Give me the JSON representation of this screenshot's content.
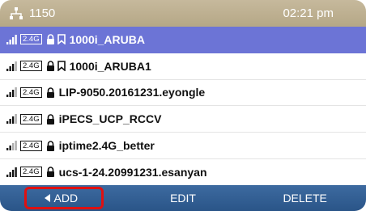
{
  "status_bar": {
    "extension": "1150",
    "time": "02:21 pm",
    "network_icon": "network-icon"
  },
  "wifi_list": [
    {
      "signal": 4,
      "band": "2.4G",
      "secured": true,
      "saved": true,
      "ssid": "1000i_ARUBA",
      "selected": true
    },
    {
      "signal": 3,
      "band": "2.4G",
      "secured": true,
      "saved": true,
      "ssid": "1000i_ARUBA1",
      "selected": false
    },
    {
      "signal": 3,
      "band": "2.4G",
      "secured": true,
      "saved": false,
      "ssid": "LIP-9050.20161231.eyongle",
      "selected": false
    },
    {
      "signal": 3,
      "band": "2.4G",
      "secured": true,
      "saved": false,
      "ssid": "iPECS_UCP_RCCV",
      "selected": false
    },
    {
      "signal": 2,
      "band": "2.4G",
      "secured": true,
      "saved": false,
      "ssid": "iptime2.4G_better",
      "selected": false
    },
    {
      "signal": 4,
      "band": "2.4G",
      "secured": true,
      "saved": false,
      "ssid": "ucs-1-24.20991231.esanyan",
      "selected": false
    }
  ],
  "soft_keys": {
    "add": "ADD",
    "edit": "EDIT",
    "delete": "DELETE"
  },
  "colors": {
    "selected_row": "#6c74d6",
    "soft_key_bar": "#2a5588",
    "highlight": "#e01010"
  }
}
